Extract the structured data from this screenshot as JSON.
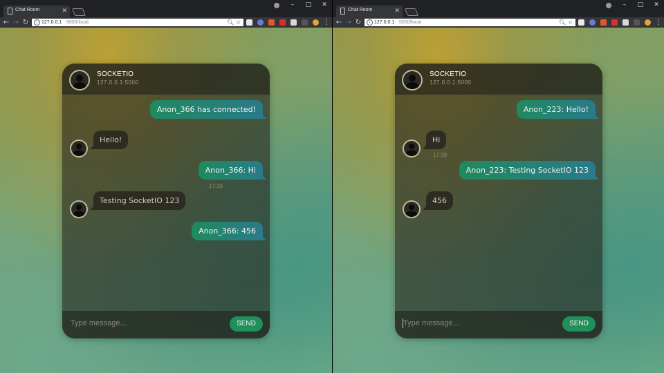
{
  "colors": {
    "bubble_out_start": "#1f8a5e",
    "bubble_out_end": "#2a7a8a",
    "send_button": "#20905a",
    "chrome_frame": "#202124",
    "chrome_toolbar": "#35363a"
  },
  "windows": [
    {
      "tab_title": "Chat Room",
      "url_host": "127.0.0.1",
      "url_path": ":5000/local",
      "chat": {
        "room_name": "SOCKETIO",
        "room_host": "127.0.0.1:5000",
        "messages": [
          {
            "dir": "out",
            "text": "Anon_366 has connected!"
          },
          {
            "dir": "in",
            "text": "Hello!"
          },
          {
            "dir": "out",
            "text": "Anon_366: Hi",
            "time": "17:39"
          },
          {
            "dir": "in",
            "text": "Testing SocketIO 123"
          },
          {
            "dir": "out",
            "text": "Anon_366: 456"
          }
        ],
        "input_placeholder": "Type message...",
        "send_label": "SEND"
      }
    },
    {
      "tab_title": "Chat Room",
      "url_host": "127.0.0.1",
      "url_path": ":5000/local",
      "chat": {
        "room_name": "SOCKETIO",
        "room_host": "127.0.0.1:5000",
        "messages": [
          {
            "dir": "out",
            "text": "Anon_223: Hello!"
          },
          {
            "dir": "in",
            "text": "Hi",
            "time": "17:39"
          },
          {
            "dir": "out",
            "text": "Anon_223: Testing SocketIO 123"
          },
          {
            "dir": "in",
            "text": "456"
          }
        ],
        "input_placeholder": "Type message...",
        "send_label": "SEND"
      }
    }
  ]
}
